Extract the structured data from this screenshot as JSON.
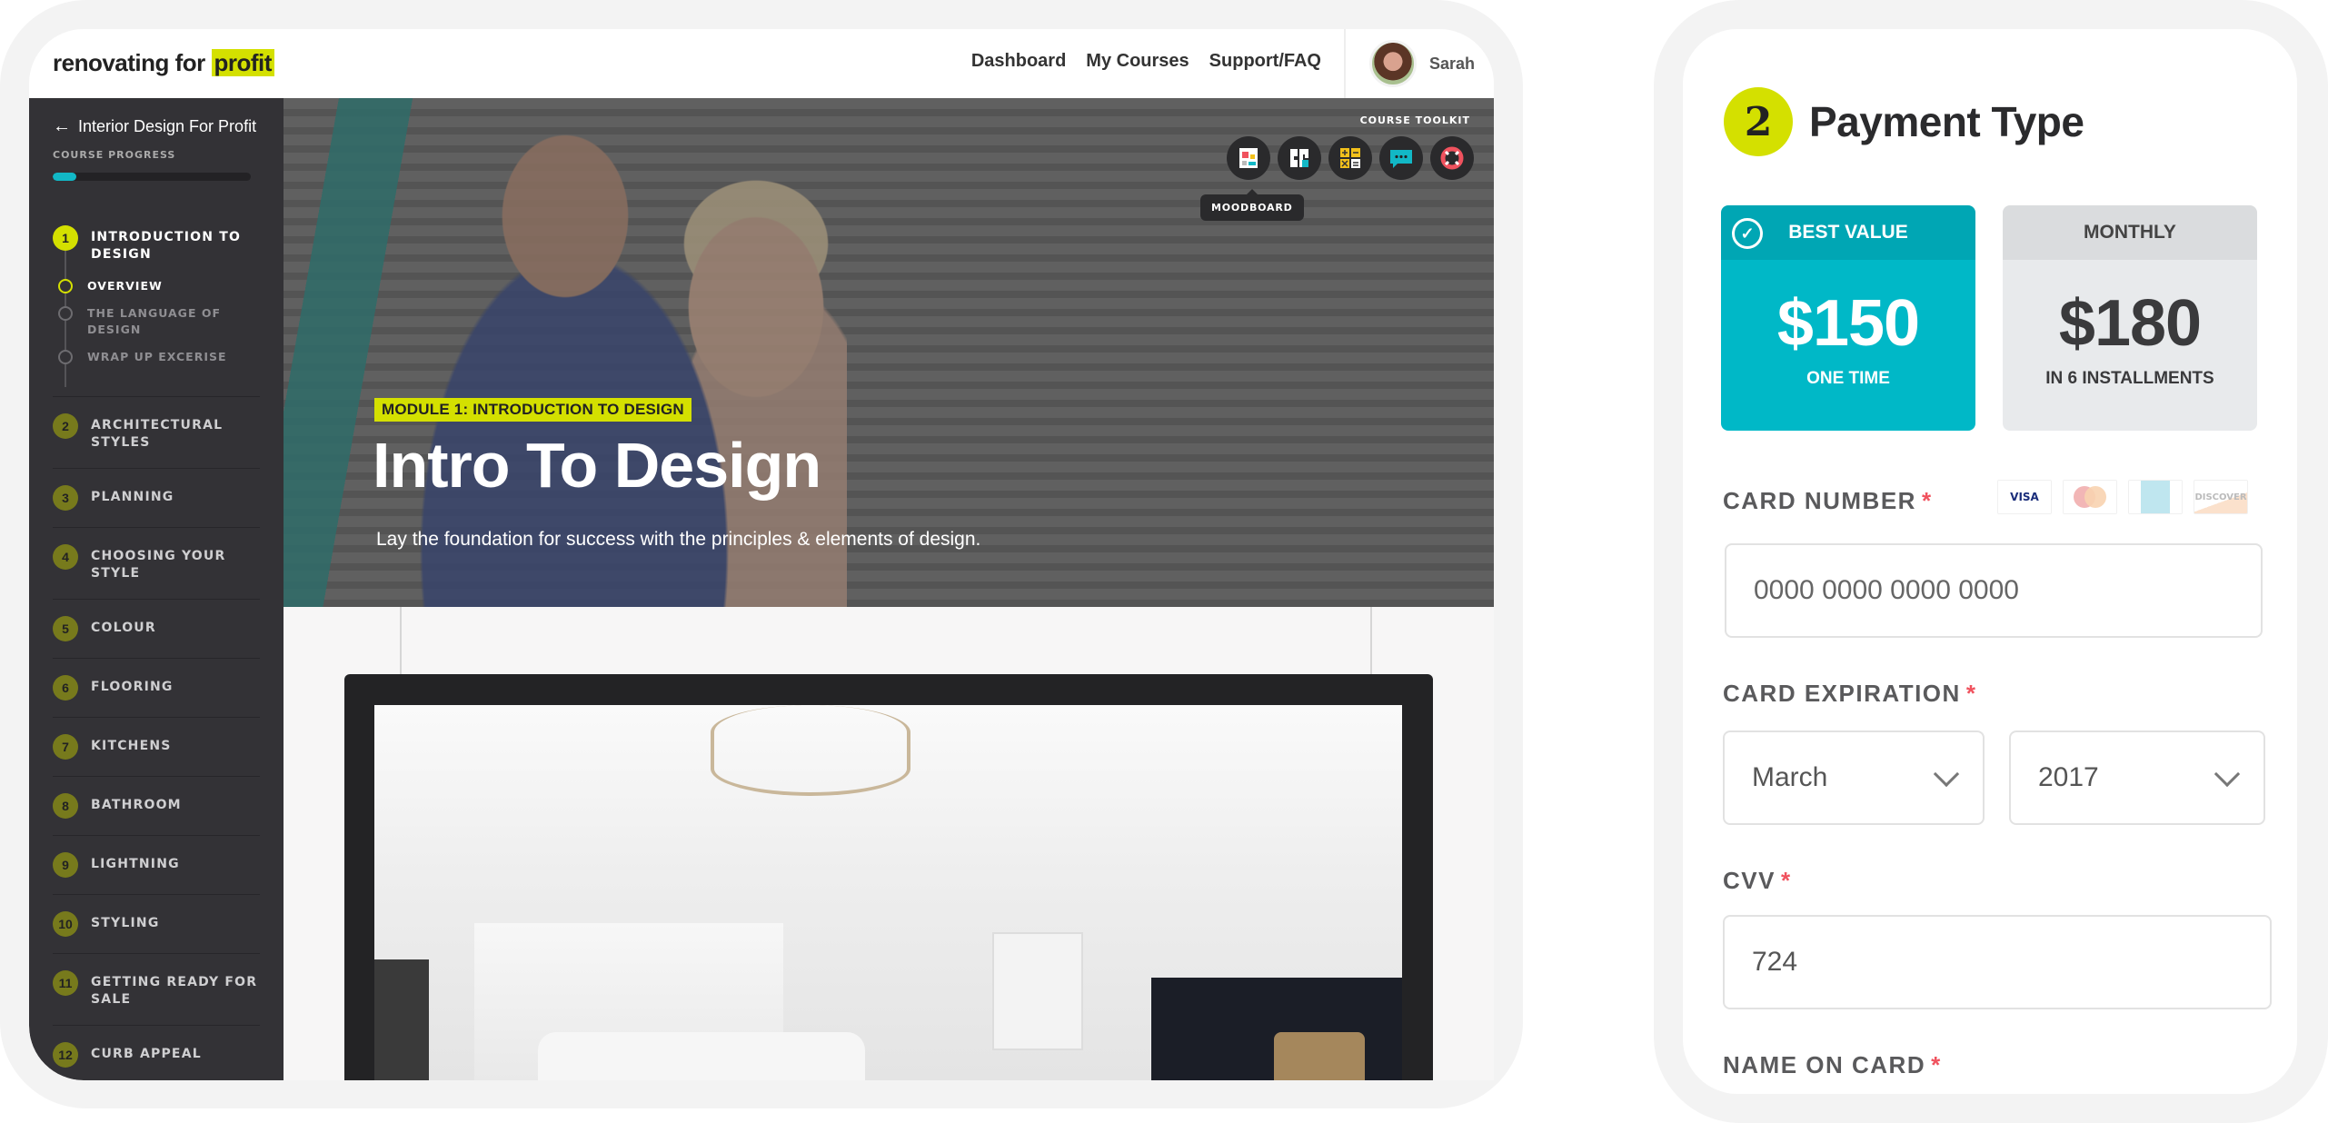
{
  "course_page": {
    "logo": {
      "text": "renovating for ",
      "highlight": "profit"
    },
    "nav": [
      "Dashboard",
      "My Courses",
      "Support/FAQ"
    ],
    "user": {
      "name": "Sarah"
    },
    "sidebar": {
      "back_label": "Interior Design For Profit",
      "progress_label": "COURSE PROGRESS",
      "progress_percent": 12,
      "modules": [
        {
          "num": "1",
          "label": "INTRODUCTION TO DESIGN",
          "active": true,
          "lessons": [
            {
              "label": "OVERVIEW",
              "active": true
            },
            {
              "label": "THE LANGUAGE OF DESIGN",
              "active": false
            },
            {
              "label": "WRAP UP EXCERISE",
              "active": false
            }
          ]
        },
        {
          "num": "2",
          "label": "ARCHITECTURAL STYLES"
        },
        {
          "num": "3",
          "label": "PLANNING"
        },
        {
          "num": "4",
          "label": "CHOOSING YOUR STYLE"
        },
        {
          "num": "5",
          "label": "COLOUR"
        },
        {
          "num": "6",
          "label": "FLOORING"
        },
        {
          "num": "7",
          "label": "KITCHENS"
        },
        {
          "num": "8",
          "label": "BATHROOM"
        },
        {
          "num": "9",
          "label": "LIGHTNING"
        },
        {
          "num": "10",
          "label": "STYLING"
        },
        {
          "num": "11",
          "label": "GETTING READY FOR SALE"
        },
        {
          "num": "12",
          "label": "CURB APPEAL"
        }
      ]
    },
    "hero": {
      "toolkit_label": "COURSE TOOLKIT",
      "tools": [
        {
          "name": "moodboard",
          "icon": "moodboard-icon"
        },
        {
          "name": "floorplan",
          "icon": "floorplan-icon"
        },
        {
          "name": "calculator",
          "icon": "calculator-icon"
        },
        {
          "name": "chat",
          "icon": "chat-icon"
        },
        {
          "name": "support",
          "icon": "lifebuoy-icon"
        }
      ],
      "tooltip": "MOODBOARD",
      "module_badge": "MODULE 1: INTRODUCTION TO DESIGN",
      "title": "Intro To Design",
      "subtitle": "Lay the foundation for success with the principles & elements of design."
    }
  },
  "payment": {
    "step_number": "2",
    "title": "Payment Type",
    "plans": [
      {
        "header": "BEST VALUE",
        "price": "$150",
        "note": "ONE TIME",
        "selected": true
      },
      {
        "header": "MONTHLY",
        "price": "$180",
        "note": "IN 6 INSTALLMENTS",
        "selected": false
      }
    ],
    "card_number": {
      "label": "CARD NUMBER",
      "required": "*",
      "placeholder": "0000 0000 0000 0000"
    },
    "card_brands": [
      "VISA",
      "MasterCard",
      "AMEX",
      "DISCOVER"
    ],
    "card_expiration": {
      "label": "CARD EXPIRATION",
      "required": "*",
      "month": "March",
      "year": "2017"
    },
    "cvv": {
      "label": "CVV",
      "required": "*",
      "value": "724"
    },
    "name_on_card": {
      "label": "NAME ON CARD",
      "required": "*"
    }
  },
  "colors": {
    "accent_lime": "#d4e000",
    "accent_teal": "#00b8c7",
    "sidebar_bg": "#333236",
    "required_red": "#f0525e"
  }
}
